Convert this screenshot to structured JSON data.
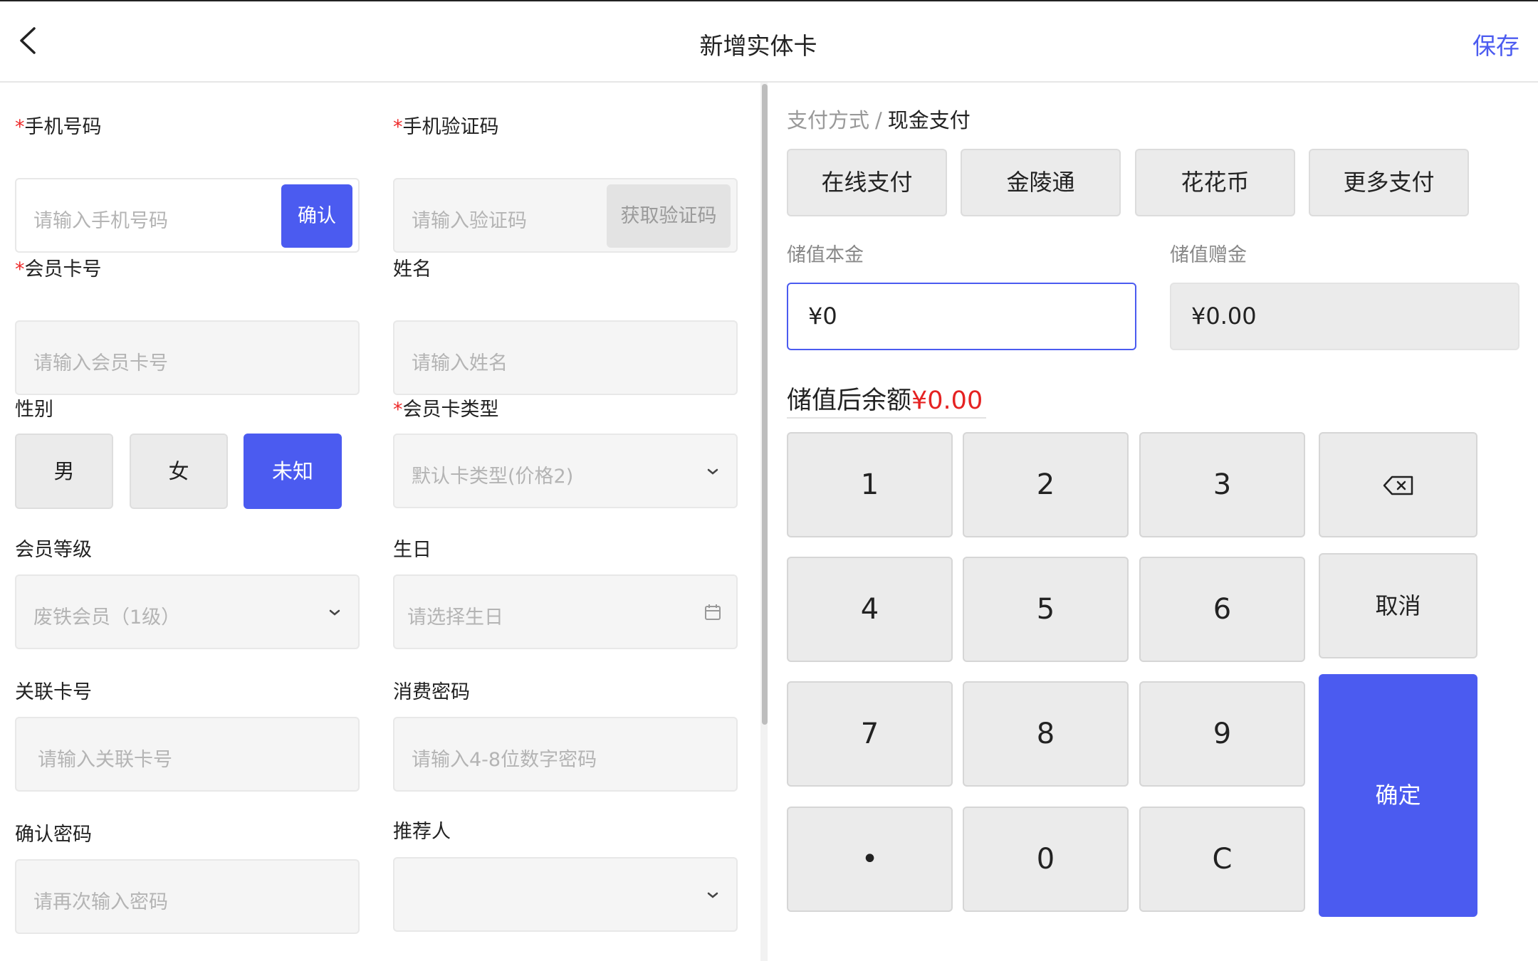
{
  "header": {
    "title": "新增实体卡",
    "save_label": "保存"
  },
  "form": {
    "phone": {
      "required_mark": "*",
      "label": "手机号码",
      "placeholder": "请输入手机号码",
      "button": "确认"
    },
    "verify_code": {
      "required_mark": "*",
      "label": "手机验证码",
      "placeholder": "请输入验证码",
      "button": "获取验证码"
    },
    "card_no": {
      "required_mark": "*",
      "label": "会员卡号",
      "placeholder": "请输入会员卡号"
    },
    "name": {
      "label": "姓名",
      "placeholder": "请输入姓名"
    },
    "gender": {
      "label": "性别",
      "options": [
        "男",
        "女",
        "未知"
      ],
      "selected": "未知"
    },
    "card_type": {
      "required_mark": "*",
      "label": "会员卡类型",
      "value": "默认卡类型(价格2)"
    },
    "level": {
      "label": "会员等级",
      "value": "废铁会员（1级）"
    },
    "birthday": {
      "label": "生日",
      "placeholder": "请选择生日"
    },
    "linked_card": {
      "label": "关联卡号",
      "placeholder": "请输入关联卡号"
    },
    "consume_password": {
      "label": "消费密码",
      "placeholder": "请输入4-8位数字密码"
    },
    "confirm_password": {
      "label": "确认密码",
      "placeholder": "请再次输入密码"
    },
    "referrer": {
      "label": "推荐人",
      "value": ""
    }
  },
  "payment": {
    "breadcrumb_parent": "支付方式",
    "breadcrumb_sep": "/",
    "breadcrumb_current": "现金支付",
    "methods": [
      "在线支付",
      "金陵通",
      "花花币",
      "更多支付"
    ],
    "principal_label": "储值本金",
    "principal_value": "¥0",
    "bonus_label": "储值赠金",
    "bonus_value": "¥0.00",
    "balance_label": "储值后余额",
    "balance_value": "¥0.00"
  },
  "keypad": {
    "keys": [
      "1",
      "2",
      "3",
      "4",
      "5",
      "6",
      "7",
      "8",
      "9",
      "•",
      "0",
      "C"
    ],
    "cancel": "取消",
    "confirm": "确定"
  },
  "colors": {
    "accent": "#4b5bf0",
    "required": "#ee2b2b",
    "balance": "#e52222",
    "disabled_bg": "#ebebeb"
  },
  "icons": {
    "back": "chevron-left-icon",
    "dropdown": "chevron-down-icon",
    "calendar": "calendar-icon",
    "backspace": "backspace-icon"
  }
}
